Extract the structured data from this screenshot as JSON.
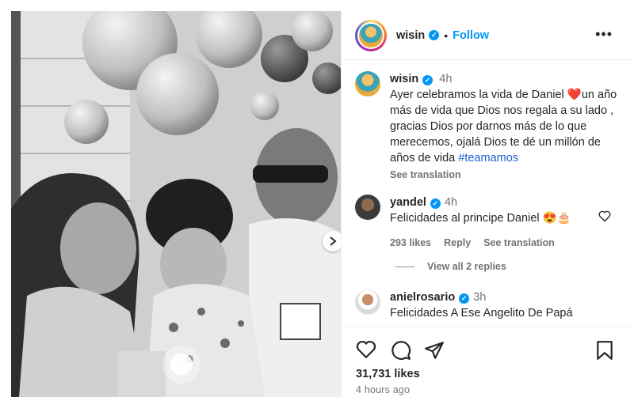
{
  "post": {
    "author": "wisin",
    "follow_label": "Follow",
    "caption_author": "wisin",
    "caption_time": "4h",
    "caption_text": "Ayer celebramos la vida de Daniel ❤️un año más de vida que Dios nos regala a su lado , gracias Dios por darnos más de lo que merecemos, ojalá Dios te dé un millón de años de vida ",
    "caption_hashtag": "#teamamos",
    "see_translation": "See translation"
  },
  "comments": [
    {
      "user": "yandel",
      "time": "4h",
      "text": "Felicidades al principe Daniel 😍🎂",
      "likes": "293 likes",
      "reply_label": "Reply",
      "translate_label": "See translation"
    },
    {
      "user": "anielrosario",
      "time": "3h",
      "text": "Felicidades A Ese Angelito De Papá"
    }
  ],
  "view_replies": "View all 2 replies",
  "footer": {
    "likes": "31,731 likes",
    "posted_ago": "4 hours ago"
  },
  "colors": {
    "accent": "#0095f6",
    "muted": "#737373",
    "border": "#efefef"
  },
  "icons": [
    "more-icon",
    "verified-icon",
    "heart-icon",
    "comment-icon",
    "share-icon",
    "bookmark-icon",
    "chevron-right-icon"
  ]
}
